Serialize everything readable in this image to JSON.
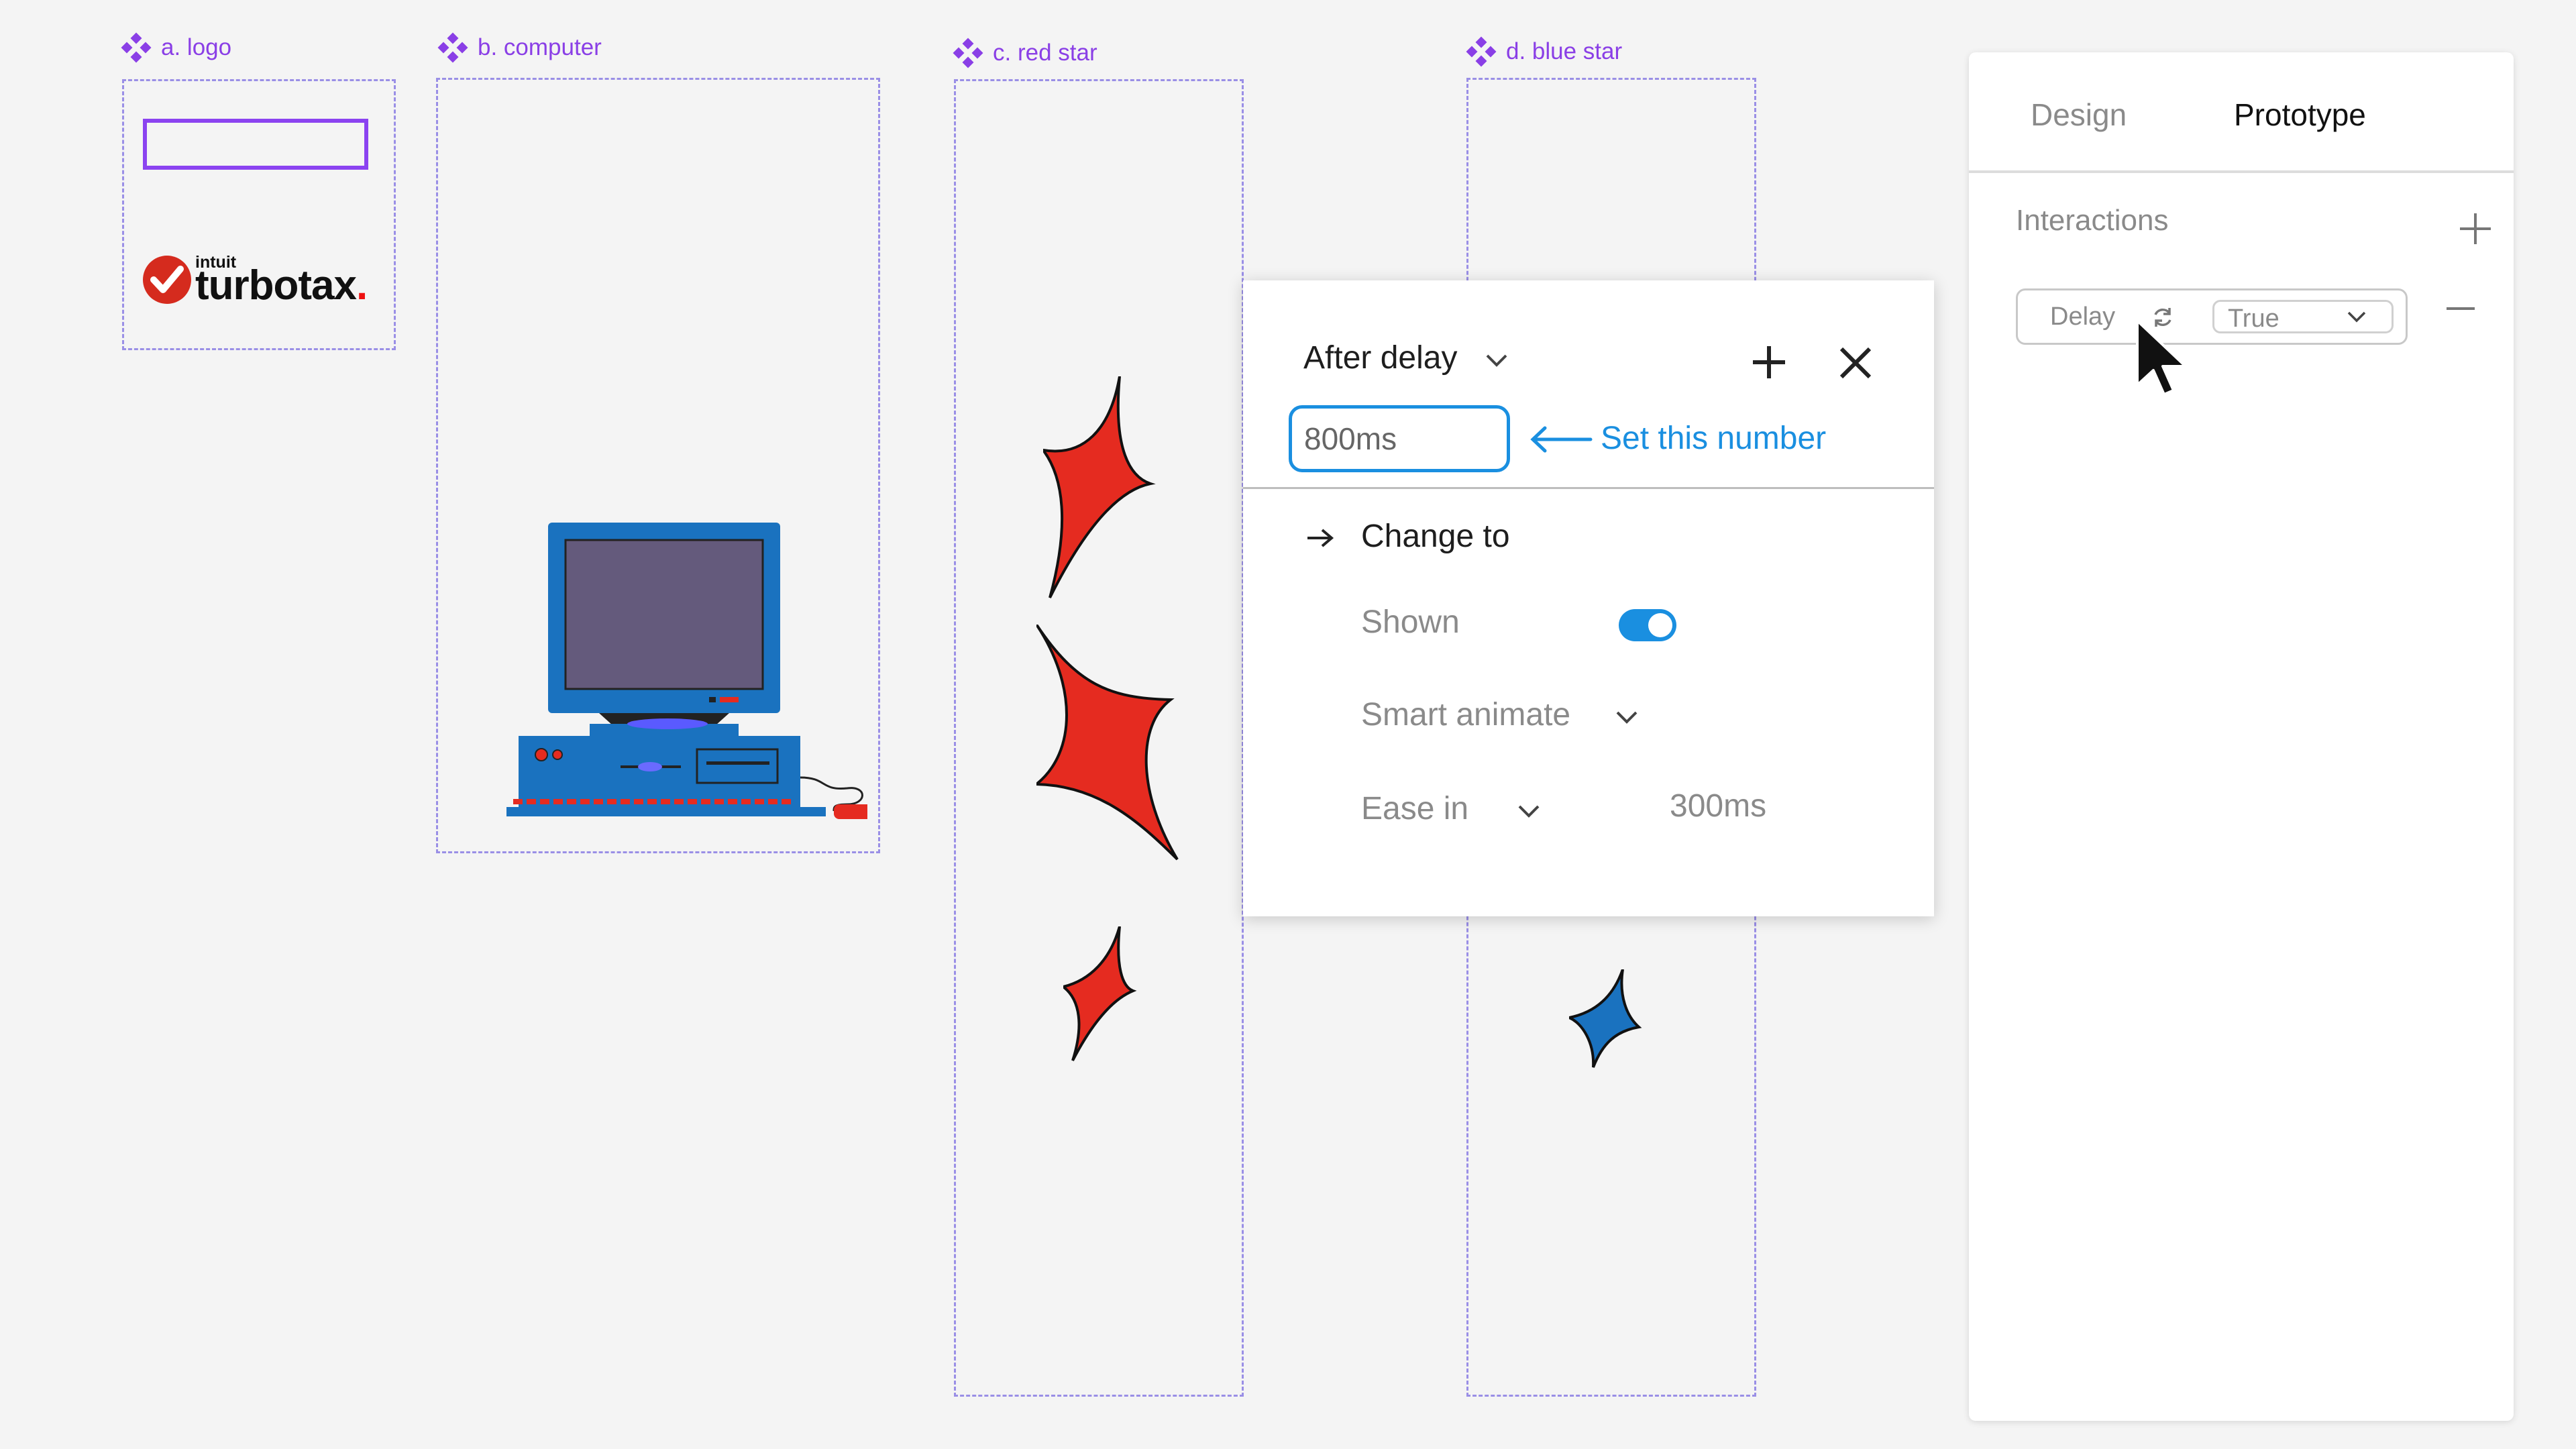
{
  "components": {
    "logo": {
      "label": "a. logo",
      "brand_small": "intuit",
      "brand_word": "turbotax",
      "brand_dot": "."
    },
    "computer": {
      "label": "b. computer"
    },
    "red_star": {
      "label": "c. red star"
    },
    "blue_star": {
      "label": "d. blue star"
    }
  },
  "panel": {
    "tabs": [
      {
        "label": "Design",
        "active": false
      },
      {
        "label": "Prototype",
        "active": true
      }
    ],
    "section_title": "Interactions",
    "interaction": {
      "trigger": "Delay",
      "value": "True"
    }
  },
  "popup": {
    "trigger": "After delay",
    "delay_value": "800ms",
    "hint": "Set this number",
    "action": "Change to",
    "property": "Shown",
    "toggle_on": true,
    "animation": "Smart animate",
    "easing": "Ease in",
    "duration": "300ms"
  },
  "colors": {
    "accent_blue": "#1a8fe0",
    "component_purple": "#8a3fe6",
    "red_star": "#e52b20",
    "blue_star": "#1a72bf"
  },
  "icons": [
    "component-icon",
    "plus-icon",
    "close-icon",
    "chevron-down-icon",
    "arrow-left-icon",
    "arrow-right-icon",
    "swap-icon",
    "minus-icon",
    "cursor-icon"
  ]
}
